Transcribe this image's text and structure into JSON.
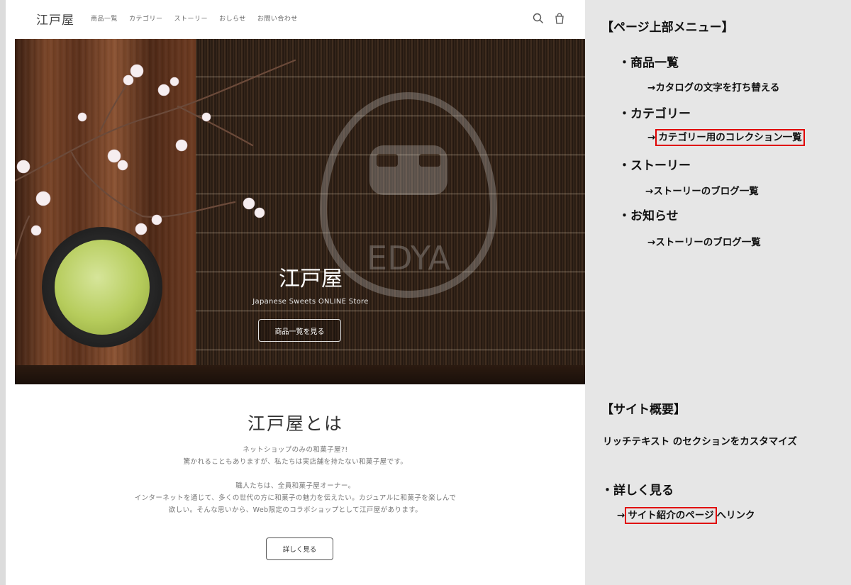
{
  "site": {
    "logo": "江戸屋",
    "nav": [
      "商品一覧",
      "カテゴリー",
      "ストーリー",
      "おしらせ",
      "お問い合わせ"
    ],
    "icons": {
      "search": "search-icon",
      "cart": "cart-icon"
    },
    "hero": {
      "watermark_text": "EDYA",
      "title": "江戸屋",
      "subtitle": "Japanese Sweets ONLINE Store",
      "button": "商品一覧を見る"
    },
    "about": {
      "title": "江戸屋とは",
      "para1": [
        "ネットショップのみの和菓子屋?!",
        "驚かれることもありますが、私たちは実店舗を持たない和菓子屋です。"
      ],
      "para2": [
        "職人たちは、全員和菓子屋オーナー。",
        "インターネットを通じて、多くの世代の方に和菓子の魅力を伝えたい。カジュアルに和菓子を楽しんで",
        "欲しい。そんな思いから、Web限定のコラボショップとして江戸屋があります。"
      ],
      "button": "詳しく見る"
    }
  },
  "notes": {
    "menu_heading": "【ページ上部メニュー】",
    "menu_items": [
      {
        "label": "・商品一覧",
        "note_arrow": "→",
        "note": "カタログの文字を打ち替える",
        "highlight": false
      },
      {
        "label": "・カテゴリー",
        "note_arrow": "→",
        "note": "カテゴリー用のコレクション一覧",
        "highlight": true
      },
      {
        "label": "・ストーリー",
        "note_arrow": "→",
        "note": "ストーリーのブログ一覧",
        "highlight": false
      },
      {
        "label": "・お知らせ",
        "note_arrow": "→",
        "note": "ストーリーのブログ一覧",
        "highlight": false
      }
    ],
    "overview_heading": "【サイト概要】",
    "overview_text": "リッチテキスト のセクションをカスタマイズ",
    "detail_item": "・詳しく見る",
    "detail_arrow": "→",
    "detail_link": "サイト紹介のページ",
    "detail_suffix": "へリンク",
    "highlight_color": "#e00000"
  }
}
